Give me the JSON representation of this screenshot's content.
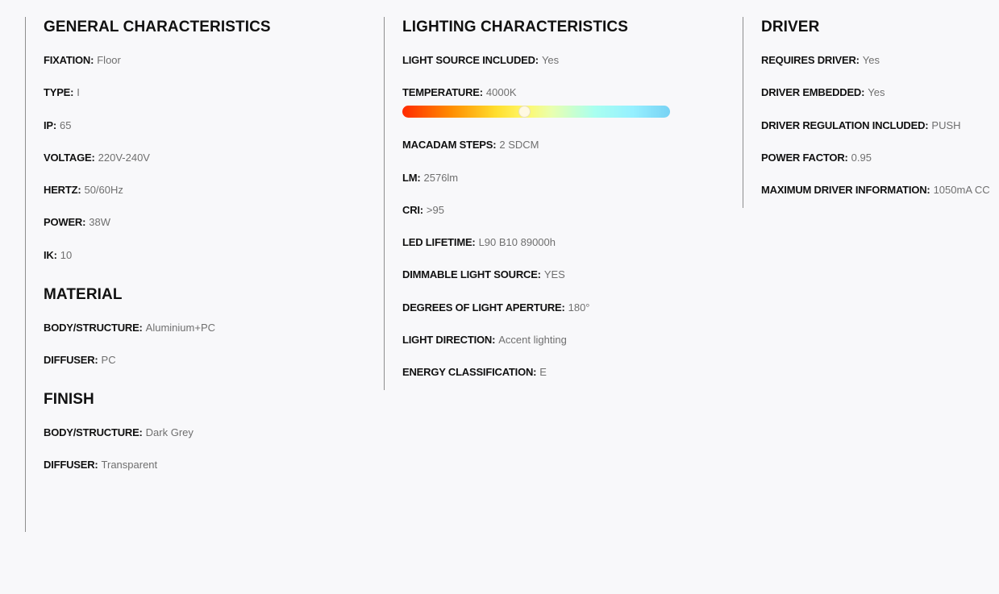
{
  "general": {
    "title": "GENERAL CHARACTERISTICS",
    "items": [
      {
        "label": "FIXATION:",
        "value": "Floor"
      },
      {
        "label": "TYPE:",
        "value": "I"
      },
      {
        "label": "IP:",
        "value": "65"
      },
      {
        "label": "VOLTAGE:",
        "value": "220V-240V"
      },
      {
        "label": "HERTZ:",
        "value": "50/60Hz"
      },
      {
        "label": "POWER:",
        "value": "38W"
      },
      {
        "label": "IK:",
        "value": "10"
      }
    ]
  },
  "material": {
    "title": "MATERIAL",
    "items": [
      {
        "label": "BODY/STRUCTURE:",
        "value": "Aluminium+PC"
      },
      {
        "label": "DIFFUSER:",
        "value": "PC"
      }
    ]
  },
  "finish": {
    "title": "FINISH",
    "items": [
      {
        "label": "BODY/STRUCTURE:",
        "value": "Dark Grey"
      },
      {
        "label": "DIFFUSER:",
        "value": "Transparent"
      }
    ]
  },
  "lighting": {
    "title": "LIGHTING CHARACTERISTICS",
    "items": [
      {
        "label": "LIGHT SOURCE INCLUDED:",
        "value": "Yes"
      },
      {
        "label": "TEMPERATURE:",
        "value": "4000K"
      },
      {
        "label": "MACADAM STEPS:",
        "value": "2 SDCM"
      },
      {
        "label": "LM:",
        "value": "2576lm"
      },
      {
        "label": "CRI:",
        "value": ">95"
      },
      {
        "label": "LED LIFETIME:",
        "value": "L90 B10 89000h"
      },
      {
        "label": "DIMMABLE LIGHT SOURCE:",
        "value": "YES"
      },
      {
        "label": "DEGREES OF LIGHT APERTURE:",
        "value": "180°"
      },
      {
        "label": "LIGHT DIRECTION:",
        "value": "Accent lighting"
      },
      {
        "label": "ENERGY CLASSIFICATION:",
        "value": "E"
      }
    ],
    "temperature_scale_position": 0.457
  },
  "driver": {
    "title": "DRIVER",
    "items": [
      {
        "label": "REQUIRES DRIVER:",
        "value": "Yes"
      },
      {
        "label": "DRIVER EMBEDDED:",
        "value": "Yes"
      },
      {
        "label": "DRIVER REGULATION INCLUDED:",
        "value": "PUSH"
      },
      {
        "label": "POWER FACTOR:",
        "value": "0.95"
      },
      {
        "label": "MAXIMUM DRIVER INFORMATION:",
        "value": "1050mA CC"
      }
    ]
  }
}
